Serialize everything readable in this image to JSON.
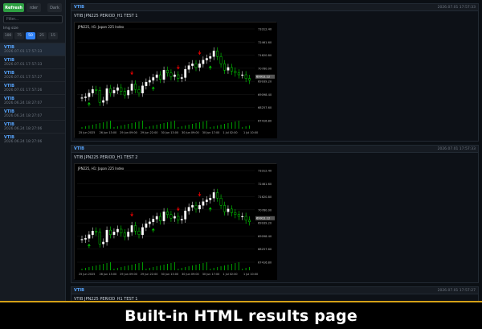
{
  "sidebar": {
    "refresh_label": "Refresh",
    "btn2_label": "rder",
    "dark_label": "Dark",
    "filter_placeholder": "Filter...",
    "section_label": "Img size",
    "page_sizes": [
      "100",
      "75",
      "50",
      "25",
      "15"
    ],
    "active_page_size": "50",
    "items": [
      {
        "name": "VTIB",
        "date": "2026.07.01 17:57:33"
      },
      {
        "name": "VTIB",
        "date": "2026.07.01 17:57:33"
      },
      {
        "name": "VTIB",
        "date": "2026.07.01 17:57:27"
      },
      {
        "name": "VTIB",
        "date": "2026.07.01 17:57:26"
      },
      {
        "name": "VTIB",
        "date": "2026.06.24 18:27:07"
      },
      {
        "name": "VTIB",
        "date": "2026.06.24 18:27:07"
      },
      {
        "name": "VTIB",
        "date": "2026.06.24 18:27:06"
      },
      {
        "name": "VTIB",
        "date": "2026.06.24 18:27:06"
      }
    ]
  },
  "cards": [
    {
      "name": "VTIB",
      "date": "2026.07.01 17:57:33",
      "title": "VTIB JPN225 PERIOD_H1 TEST 1",
      "has_chart": true
    },
    {
      "name": "VTIB",
      "date": "2026.07.01 17:57:33",
      "title": "VTIB JPN225 PERIOD_H1 TEST 2",
      "has_chart": true
    },
    {
      "name": "VTIB",
      "date": "2026.07.01 17:57:27",
      "title": "VTIB JPN225 PERIOD_H1 TEST 1",
      "has_chart": false
    }
  ],
  "chart_data": {
    "type": "candlestick",
    "title": "JPN225, H1:  Japan 225 Index",
    "price_ticks": [
      "73312.40",
      "72461.60",
      "71620.80",
      "70780.00",
      "69939.20",
      "69098.40",
      "68257.60",
      "67416.80"
    ],
    "time_ticks": [
      "25 Jun 2025",
      "26 Jun 13:00",
      "29 Jun 09:00",
      "29 Jun 22:00",
      "30 Jun 13:00",
      "30 Jun 09:00",
      "30 Jun 17:00",
      "1 Jul 02:00",
      "1 Jul 10:00"
    ],
    "current_price": "69912.12",
    "ylim": [
      67416.8,
      73312.4
    ],
    "colors": {
      "up": "#ffffff",
      "down": "#00ff00",
      "buy_arrow": "#00c000",
      "sell_arrow": "#e00000",
      "grid": "#1a1a1a",
      "volume": "#00a000"
    }
  },
  "banner": {
    "text": "Built-in HTML results page"
  }
}
